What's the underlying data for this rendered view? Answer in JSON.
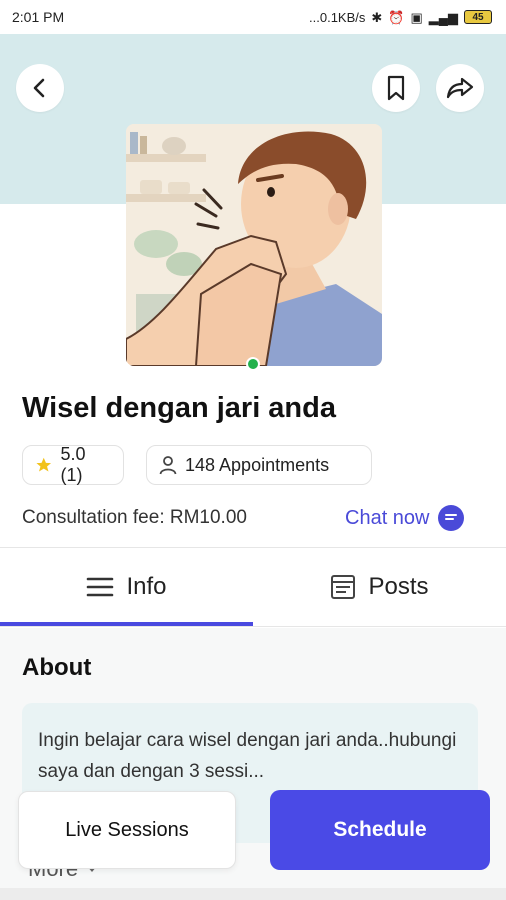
{
  "status_bar": {
    "time": "2:01 PM",
    "network_speed": "...0.1KB/s",
    "battery": "45",
    "icons": [
      "bluetooth-icon",
      "alarm-icon",
      "data-icon",
      "signal-icon",
      "battery-icon"
    ]
  },
  "header": {
    "back_icon": "chevron-left-icon",
    "bookmark_icon": "bookmark-icon",
    "share_icon": "share-icon"
  },
  "profile": {
    "name": "Wisel dengan jari anda",
    "online": true,
    "rating": "5.0 (1)",
    "appointments": "148 Appointments",
    "consultation_fee": "Consultation fee: RM10.00",
    "chat_label": "Chat now"
  },
  "tabs": [
    {
      "label": "Info",
      "icon": "menu-icon",
      "active": true
    },
    {
      "label": "Posts",
      "icon": "posts-icon",
      "active": false
    }
  ],
  "about": {
    "title": "About",
    "text": "Ingin belajar cara wisel dengan jari anda..hubungi saya dan dengan 3 sessi...",
    "more_label": "More"
  },
  "actions": {
    "live_sessions": "Live Sessions",
    "schedule": "Schedule"
  },
  "colors": {
    "accent": "#4a4ae6",
    "hero_bg": "#d6eaec",
    "online": "#22b14c",
    "star": "#f2c21b"
  }
}
